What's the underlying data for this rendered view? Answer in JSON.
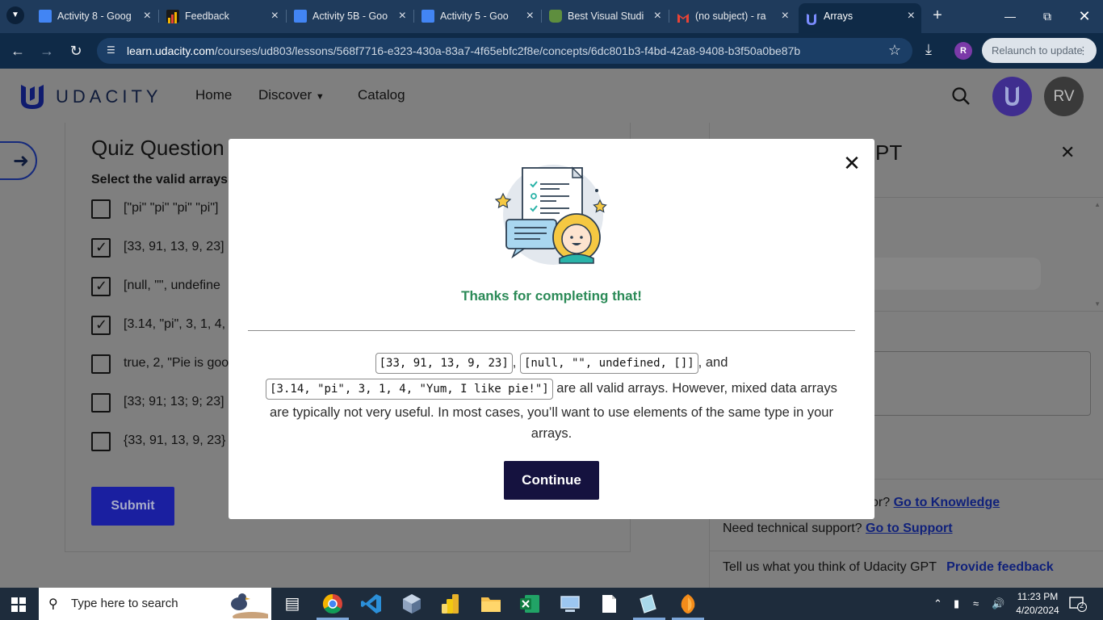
{
  "browser": {
    "tabs": [
      {
        "title": "Activity 8 - Goog",
        "icon": "google-docs-icon",
        "color": "#4285f4"
      },
      {
        "title": "Feedback",
        "icon": "chart-icon",
        "color": "#f4b400"
      },
      {
        "title": "Activity 5B - Goo",
        "icon": "google-docs-icon",
        "color": "#4285f4"
      },
      {
        "title": "Activity 5 - Goo",
        "icon": "google-docs-icon",
        "color": "#4285f4"
      },
      {
        "title": "Best Visual Studi",
        "icon": "shopify-icon",
        "color": "#5e8e3e"
      },
      {
        "title": "(no subject) - ra",
        "icon": "gmail-icon",
        "color": "#ea4335"
      },
      {
        "title": "Arrays",
        "icon": "udacity-icon",
        "color": "#6b7bff"
      }
    ],
    "url_host": "learn.udacity.com",
    "url_path": "/courses/ud803/lessons/568f7716-e323-430a-83a7-4f65ebfc2f8e/concepts/6dc801b3-f4bd-42a8-9408-b3f50a0be87b",
    "profile_initial": "R",
    "relaunch_label": "Relaunch to update"
  },
  "header": {
    "logo_text": "UDACITY",
    "nav": {
      "home": "Home",
      "discover": "Discover",
      "catalog": "Catalog"
    },
    "user_initials": "RV"
  },
  "quiz": {
    "title": "Quiz Question",
    "subtitle": "Select the valid arrays",
    "options": [
      {
        "label": "[\"pi\" \"pi\" \"pi\" \"pi\"]",
        "checked": false
      },
      {
        "label": "[33, 91, 13, 9, 23]",
        "checked": true
      },
      {
        "label": "[null, \"\", undefine",
        "checked": true
      },
      {
        "label": "[3.14, \"pi\", 3, 1, 4,",
        "checked": true
      },
      {
        "label": "true, 2, \"Pie is goo",
        "checked": false
      },
      {
        "label": "[33; 91; 13; 9; 23]",
        "checked": false
      },
      {
        "label": "{33, 91, 13, 9, 23}",
        "checked": false
      }
    ],
    "submit_label": "Submit"
  },
  "gpt_panel": {
    "title": "PT",
    "knowledge_prefix": "or?",
    "knowledge_link": "Go to Knowledge",
    "support_text": "Need technical support?",
    "support_link": "Go to Support",
    "feedback_text": "Tell us what you think of Udacity GPT",
    "feedback_link": "Provide feedback"
  },
  "modal": {
    "heading": "Thanks for completing that!",
    "code1": "[33, 91, 13, 9, 23]",
    "sep1": ",",
    "code2": "[null, \"\", undefined, []]",
    "sep2": ", and",
    "code3": "[3.14, \"pi\", 3, 1, 4, \"Yum, I like pie!\"]",
    "text_after": "are all valid arrays. However, mixed data arrays",
    "text_line3": "are typically not very useful. In most cases, you’ll want to use elements of the same type in your arrays.",
    "continue_label": "Continue"
  },
  "taskbar": {
    "search_placeholder": "Type here to search",
    "time": "11:23 PM",
    "date": "4/20/2024",
    "notification_count": "2"
  }
}
